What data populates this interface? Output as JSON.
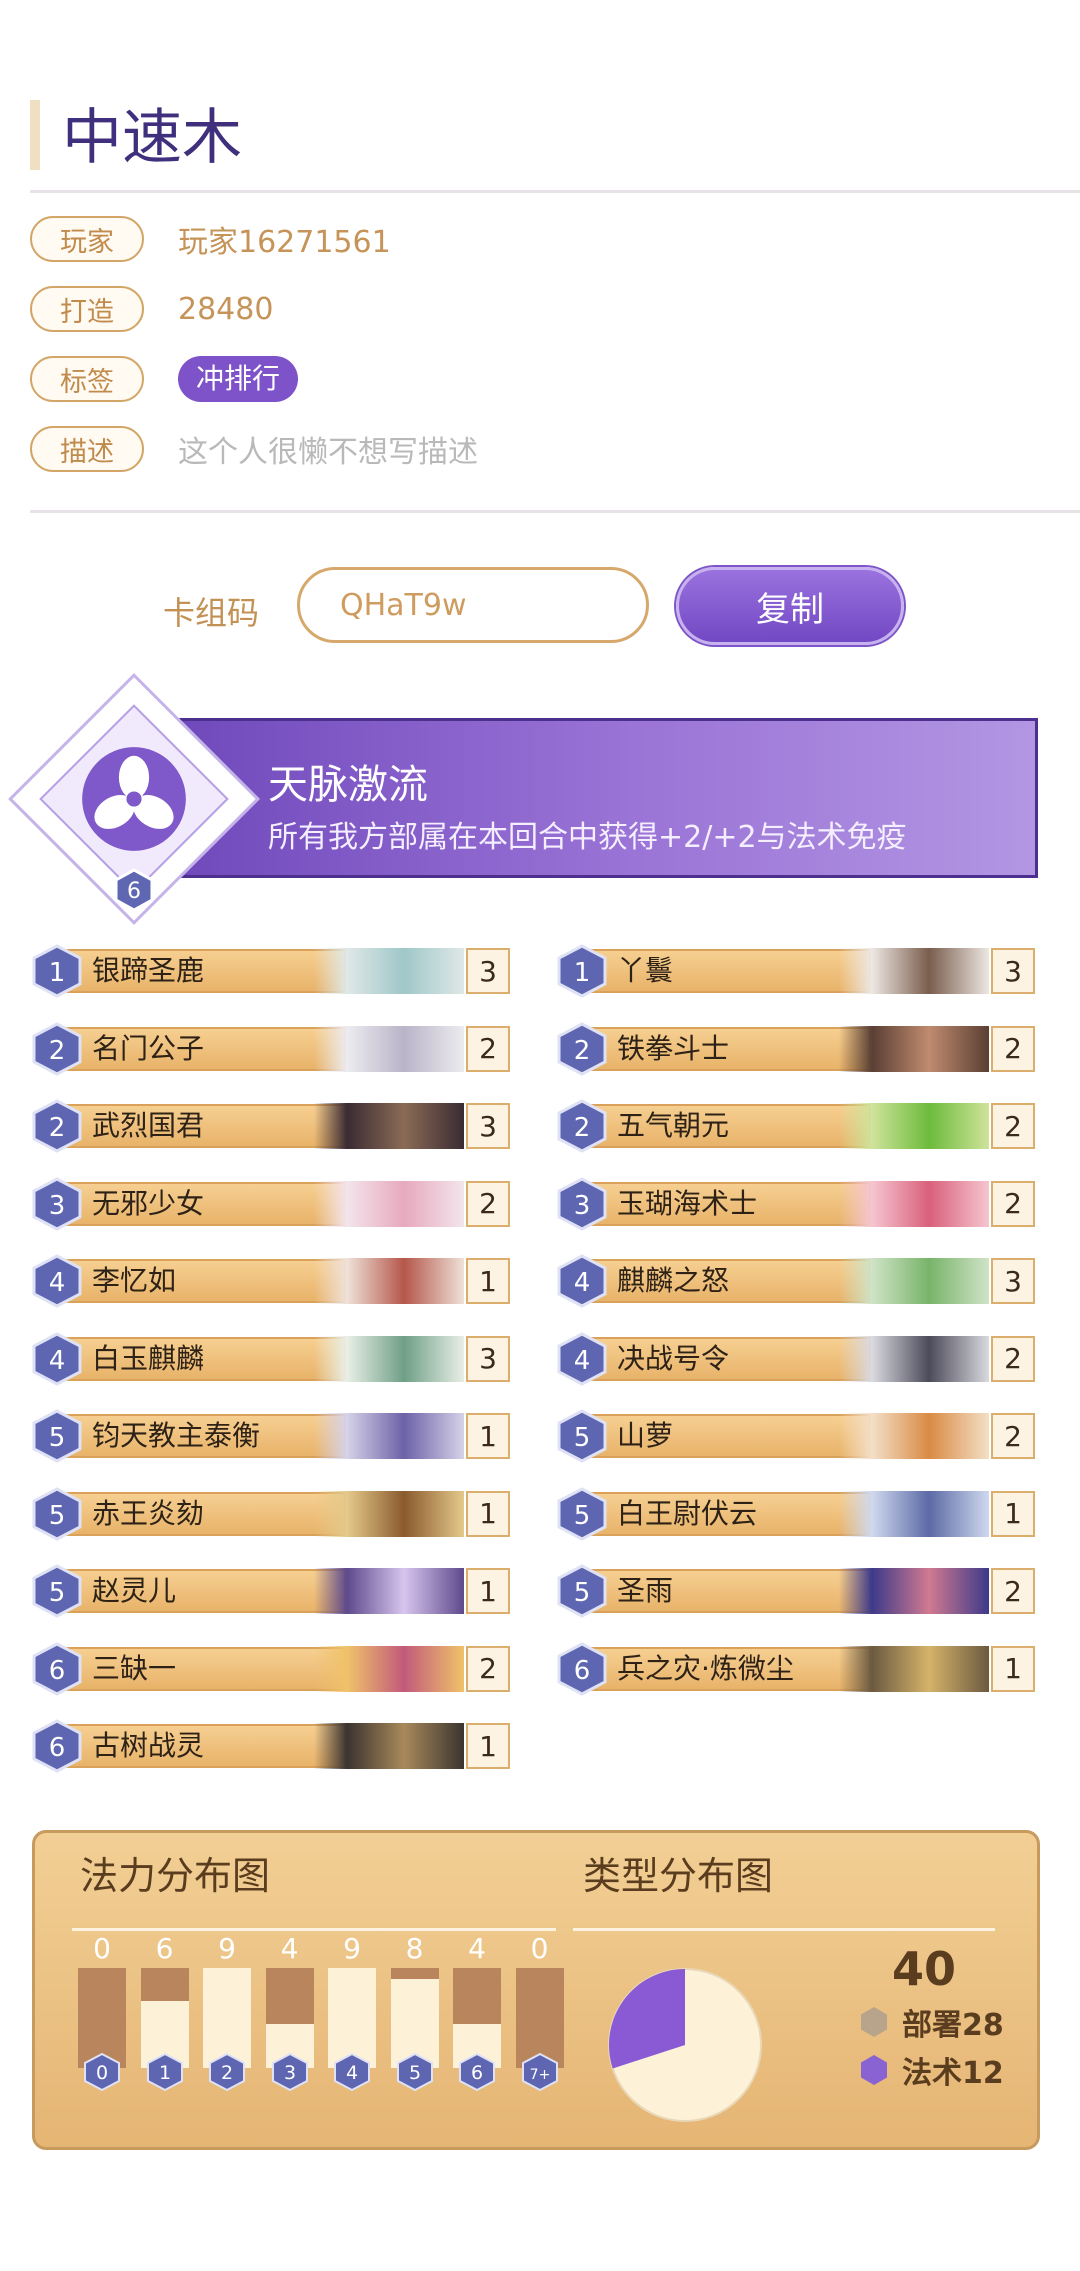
{
  "deck": {
    "title": "中速木",
    "info": [
      {
        "label": "玩家",
        "value": "玩家16271561",
        "style": "text"
      },
      {
        "label": "打造",
        "value": "28480",
        "style": "text"
      },
      {
        "label": "标签",
        "value": "冲排行",
        "style": "chip"
      },
      {
        "label": "描述",
        "value": "这个人很懒不想写描述",
        "style": "muted"
      }
    ],
    "code_label": "卡组码",
    "code_value": "QHaT9w",
    "copy_label": "复制"
  },
  "banner": {
    "title": "天脉激流",
    "description": "所有我方部属在本回合中获得+2/+2与法术免疫",
    "cost": "6",
    "emblem_icon": "trefoil-emblem-icon"
  },
  "cards_left": [
    {
      "cost": "1",
      "name": "银蹄圣鹿",
      "count": "3"
    },
    {
      "cost": "2",
      "name": "名门公子",
      "count": "2"
    },
    {
      "cost": "2",
      "name": "武烈国君",
      "count": "3"
    },
    {
      "cost": "3",
      "name": "无邪少女",
      "count": "2"
    },
    {
      "cost": "4",
      "name": "李忆如",
      "count": "1"
    },
    {
      "cost": "4",
      "name": "白玉麒麟",
      "count": "3"
    },
    {
      "cost": "5",
      "name": "钧天教主泰衡",
      "count": "1"
    },
    {
      "cost": "5",
      "name": "赤王炎劾",
      "count": "1"
    },
    {
      "cost": "5",
      "name": "赵灵儿",
      "count": "1"
    },
    {
      "cost": "6",
      "name": "三缺一",
      "count": "2"
    },
    {
      "cost": "6",
      "name": "古树战灵",
      "count": "1"
    }
  ],
  "cards_right": [
    {
      "cost": "1",
      "name": "丫鬟",
      "count": "3"
    },
    {
      "cost": "2",
      "name": "铁拳斗士",
      "count": "2"
    },
    {
      "cost": "2",
      "name": "五气朝元",
      "count": "2"
    },
    {
      "cost": "3",
      "name": "玉瑚海术士",
      "count": "2"
    },
    {
      "cost": "4",
      "name": "麒麟之怒",
      "count": "3"
    },
    {
      "cost": "4",
      "name": "决战号令",
      "count": "2"
    },
    {
      "cost": "5",
      "name": "山萝",
      "count": "2"
    },
    {
      "cost": "5",
      "name": "白王尉伏云",
      "count": "1"
    },
    {
      "cost": "5",
      "name": "圣雨",
      "count": "2"
    },
    {
      "cost": "6",
      "name": "兵之灾·炼微尘",
      "count": "1"
    }
  ],
  "stats": {
    "mana_title": "法力分布图",
    "type_title": "类型分布图",
    "total": "40",
    "legend": [
      {
        "label": "部署28",
        "color": "#b7a48a"
      },
      {
        "label": "法术12",
        "color": "#8a63d2"
      }
    ]
  },
  "colors": {
    "accent_purple": "#7e52c8",
    "gold": "#e8b36a",
    "pie_deploy": "#fdf1d8",
    "pie_spell": "#8a5ad4"
  },
  "chart_data": [
    {
      "type": "bar",
      "title": "法力分布图",
      "categories": [
        "0",
        "1",
        "2",
        "3",
        "4",
        "5",
        "6",
        "7+"
      ],
      "values": [
        0,
        6,
        9,
        4,
        9,
        8,
        4,
        0
      ],
      "ylim": [
        0,
        9
      ]
    },
    {
      "type": "pie",
      "title": "类型分布图",
      "categories": [
        "部署",
        "法术"
      ],
      "values": [
        28,
        12
      ]
    }
  ]
}
